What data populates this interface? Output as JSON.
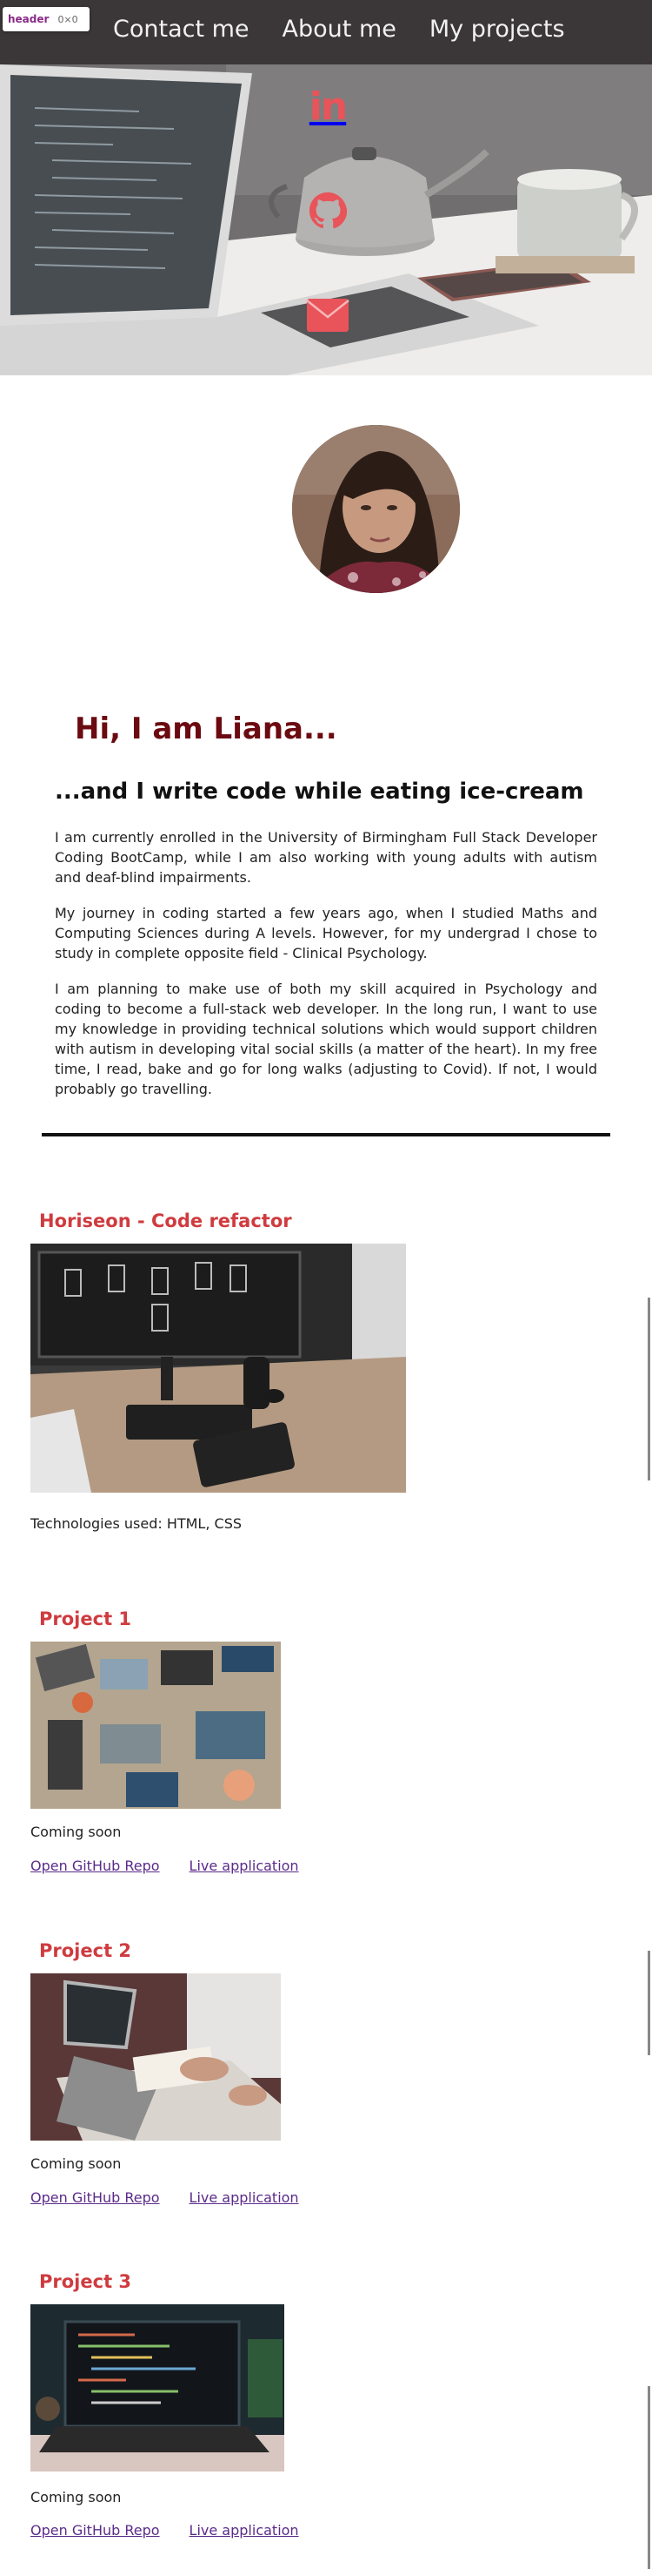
{
  "devtools": {
    "tag": "header",
    "dims": "0×0"
  },
  "nav": [
    {
      "label": "Contact me"
    },
    {
      "label": "About me"
    },
    {
      "label": "My projects"
    }
  ],
  "hero": {
    "social": [
      {
        "name": "linkedin",
        "icon": "linkedin-icon",
        "glyph": "in"
      },
      {
        "name": "github",
        "icon": "github-icon"
      },
      {
        "name": "email",
        "icon": "envelope-icon"
      }
    ],
    "icon_color": "#e85459"
  },
  "about": {
    "greeting": "Hi, I am Liana...",
    "tagline": "...and I write code while eating ice-cream",
    "paragraphs": [
      "I am currently enrolled in the University of Birmingham Full Stack Developer Coding BootCamp, while I am also working with young adults with autism and deaf-blind impairments.",
      "My journey in coding started a few years ago, when I studied Maths and Computing Sciences during A levels. However, for my undergrad I chose to study in complete opposite field - Clinical Psychology.",
      "I am planning to make use of both my skill acquired in Psychology and coding to become a full-stack web developer. In the long run, I want to use my knowledge in providing technical solutions which would support children with autism in developing vital social skills (a matter of the heart). In my free time, I read, bake and go for long walks (adjusting to Covid). If not, I would probably go travelling."
    ]
  },
  "projects": [
    {
      "title": "Horiseon - Code refactor",
      "description": "Technologies used: HTML, CSS",
      "repo": "",
      "live": ""
    },
    {
      "title": "Project 1",
      "description": "Coming soon",
      "repo": "Open GitHub Repo",
      "live": "Live application"
    },
    {
      "title": "Project 2",
      "description": "Coming soon",
      "repo": "Open GitHub Repo",
      "live": "Live application"
    },
    {
      "title": "Project 3",
      "description": "Coming soon",
      "repo": "Open GitHub Repo",
      "live": "Live application"
    }
  ],
  "colors": {
    "header_bg": "#3b3638",
    "greeting": "#6b0a10",
    "project_title": "#cf3b3f",
    "link": "#5a2b8a"
  }
}
